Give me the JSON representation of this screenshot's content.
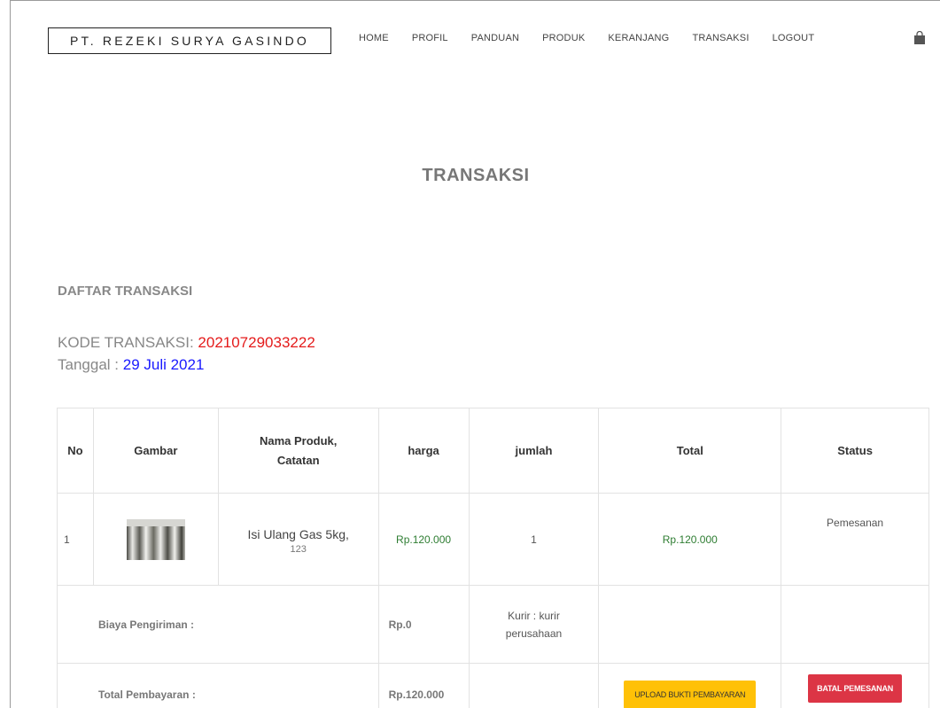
{
  "header": {
    "brand": "PT. REZEKI SURYA GASINDO",
    "nav": [
      "HOME",
      "PROFIL",
      "PANDUAN",
      "PRODUK",
      "KERANJANG",
      "TRANSAKSI",
      "LOGOUT"
    ],
    "cart_icon": "shopping-bag-icon"
  },
  "page": {
    "title": "TRANSAKSI",
    "section_title": "DAFTAR TRANSAKSI",
    "kode_label": "KODE TRANSAKSI: ",
    "kode_value": "20210729033222",
    "tanggal_label": "Tanggal : ",
    "tanggal_value": "29 Juli 2021"
  },
  "table": {
    "headers": [
      "No",
      "Gambar",
      "Nama Produk, Catatan",
      "harga",
      "jumlah",
      "Total",
      "Status"
    ],
    "rows": [
      {
        "no": "1",
        "image_icon": "gas-cylinder-image",
        "product_name": "Isi Ulang Gas 5kg,",
        "note": "123",
        "harga": "Rp.120.000",
        "jumlah": "1",
        "total": "Rp.120.000",
        "status": "Pemesanan"
      }
    ],
    "shipping": {
      "label": "Biaya Pengiriman :",
      "value": "Rp.0",
      "courier": "Kurir : kurir perusahaan"
    },
    "payment": {
      "label": "Total Pembayaran :",
      "value": "Rp.120.000",
      "upload_button": "UPLOAD BUKTI PEMBAYARAN",
      "cancel_button": "BATAL PEMESANAN"
    }
  },
  "colors": {
    "kode": "#e41b1b",
    "tanggal": "#1a1aff",
    "price": "#2e7d32",
    "upload_button": "#ffc107",
    "cancel_button": "#dc3545"
  }
}
